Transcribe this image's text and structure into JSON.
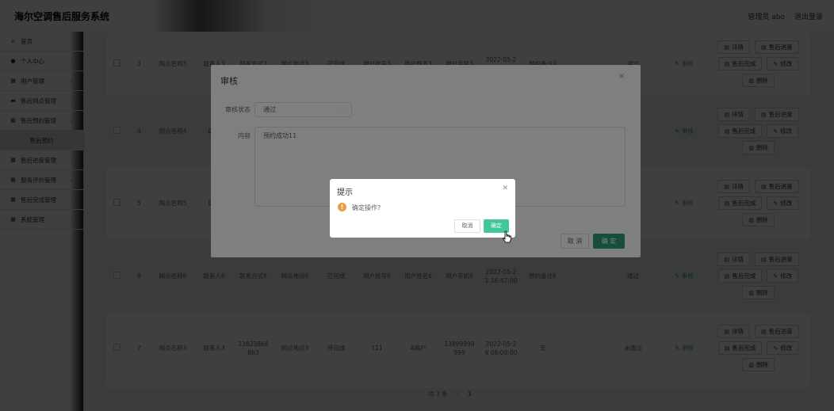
{
  "header": {
    "title": "海尔空调售后服务系统",
    "user": "管理员 abo",
    "logout": "退出登录"
  },
  "sidebar": {
    "items": [
      {
        "label": "首页",
        "icon": "home-icon",
        "glyph": "⌂",
        "arrow": false
      },
      {
        "label": "个人中心",
        "icon": "user-icon",
        "glyph": "●",
        "arrow": true
      },
      {
        "label": "用户管理",
        "icon": "grid-icon",
        "glyph": "▦",
        "arrow": true
      },
      {
        "label": "售后网点管理",
        "icon": "monitor-icon",
        "glyph": "▬",
        "arrow": true
      },
      {
        "label": "售后预约管理",
        "icon": "grid-icon",
        "glyph": "▦",
        "arrow": true
      },
      {
        "label": "售后预约",
        "icon": "",
        "glyph": "",
        "arrow": false,
        "sub": true
      },
      {
        "label": "售后进度管理",
        "icon": "grid-icon",
        "glyph": "▦",
        "arrow": true
      },
      {
        "label": "服务评价管理",
        "icon": "grid-icon",
        "glyph": "▦",
        "arrow": true
      },
      {
        "label": "售后完成管理",
        "icon": "grid-icon",
        "glyph": "▦",
        "arrow": true
      },
      {
        "label": "系统管理",
        "icon": "grid-icon",
        "glyph": "▦",
        "arrow": true
      }
    ]
  },
  "table": {
    "rows": [
      {
        "index": "3",
        "outlet": "网点名称3",
        "contact": "联系人3",
        "phone": "联系方式3",
        "address": "网点地点3",
        "status": "已完成",
        "account": "用户账号3",
        "username": "用户姓名3",
        "mobile": "用户手机3",
        "time": "2022-05-2\n1 16:47:00",
        "remark": "预约备注3",
        "extra": "",
        "audit": "通过",
        "audit_link": "审核"
      },
      {
        "index": "4",
        "outlet": "网点名称4",
        "contact": "联系",
        "phone": "",
        "address": "",
        "status": "",
        "account": "",
        "username": "",
        "mobile": "",
        "time": "",
        "remark": "",
        "extra": "",
        "audit": "",
        "audit_link": "审核"
      },
      {
        "index": "5",
        "outlet": "网点名称5",
        "contact": "联系",
        "phone": "",
        "address": "",
        "status": "",
        "account": "",
        "username": "",
        "mobile": "",
        "time": "",
        "remark": "",
        "extra": "",
        "audit": "",
        "audit_link": "审核"
      },
      {
        "index": "6",
        "outlet": "网点名称6",
        "contact": "联系人6",
        "phone": "联系方式6",
        "address": "网点地点6",
        "status": "已完成",
        "account": "用户账号6",
        "username": "用户姓名6",
        "mobile": "用户手机6",
        "time": "2022-05-2\n1 16:47:00",
        "remark": "预约备注6",
        "extra": "",
        "audit": "通过",
        "audit_link": "审核"
      },
      {
        "index": "7",
        "outlet": "网点名称3",
        "contact": "联系人3",
        "phone": "13823868\n883",
        "address": "网点地点3",
        "status": "待完成",
        "account": "111",
        "username": "A用户",
        "mobile": "13899999\n999",
        "time": "2022-05-2\n6 08:00:00",
        "remark": "无",
        "extra": "",
        "audit": "未通过",
        "audit_link": "审核"
      }
    ],
    "ops": {
      "detail": "详情",
      "progress": "售后进度",
      "complete": "售后完成",
      "edit": "修改",
      "delete": "删除"
    }
  },
  "pagination": {
    "total": "共 7 条",
    "prev": "<",
    "page": "1",
    "next": ">"
  },
  "audit_dialog": {
    "title": "审核",
    "status_label": "审核状态",
    "status_value": "通过",
    "content_label": "内容",
    "content_value": "预约成功11",
    "cancel": "取 消",
    "confirm": "确 定"
  },
  "msgbox": {
    "title": "提示",
    "message": "确定操作?",
    "cancel": "取消",
    "confirm": "确定"
  }
}
